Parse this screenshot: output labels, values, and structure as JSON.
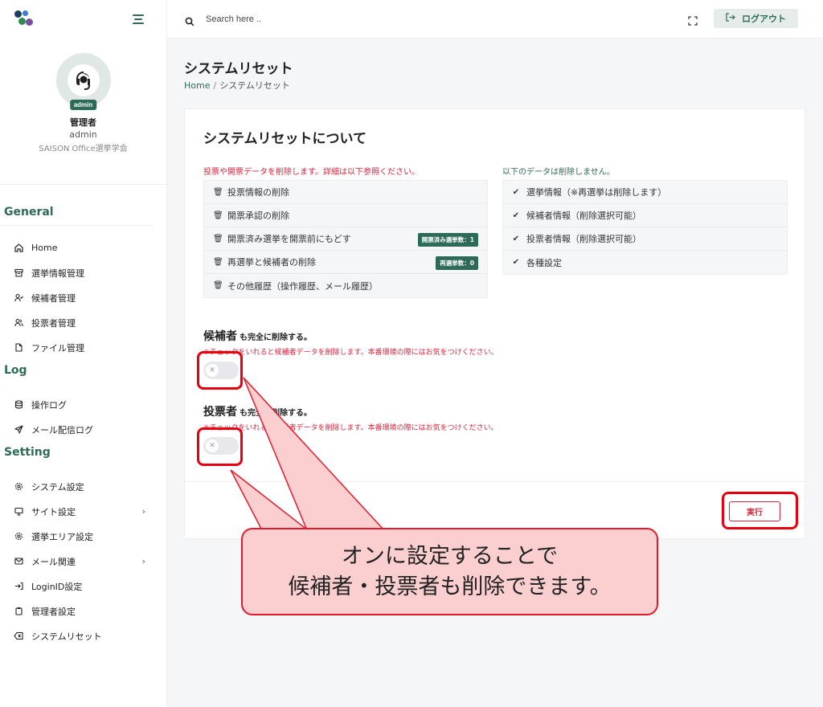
{
  "topbar": {
    "search_placeholder": "Search here ..",
    "logout_label": "ログアウト"
  },
  "profile": {
    "name": "管理者",
    "username": "admin",
    "organization": "SAISON Office選挙学会",
    "badge": "admin"
  },
  "sidebar": {
    "sections": {
      "general": "General",
      "log": "Log",
      "setting": "Setting"
    },
    "general_items": [
      {
        "label": "Home",
        "icon": "home-icon"
      },
      {
        "label": "選挙情報管理",
        "icon": "ballot-box-icon"
      },
      {
        "label": "候補者管理",
        "icon": "user-check-icon"
      },
      {
        "label": "投票者管理",
        "icon": "users-icon"
      },
      {
        "label": "ファイル管理",
        "icon": "file-icon"
      }
    ],
    "log_items": [
      {
        "label": "操作ログ",
        "icon": "database-icon"
      },
      {
        "label": "メール配信ログ",
        "icon": "send-icon"
      }
    ],
    "setting_items": [
      {
        "label": "システム設定",
        "icon": "gear-icon"
      },
      {
        "label": "サイト設定",
        "icon": "monitor-icon"
      },
      {
        "label": "選挙エリア設定",
        "icon": "gear-icon"
      },
      {
        "label": "メール関連",
        "icon": "mail-icon"
      },
      {
        "label": "LoginID設定",
        "icon": "login-icon"
      },
      {
        "label": "管理者設定",
        "icon": "clipboard-icon"
      },
      {
        "label": "システムリセット",
        "icon": "backspace-icon"
      }
    ]
  },
  "page": {
    "title": "システムリセット",
    "breadcrumb_home": "Home",
    "breadcrumb_current": "システムリセット"
  },
  "card": {
    "title": "システムリセットについて",
    "delete_heading": "投票や開票データを削除します。詳細は以下参照ください。",
    "keep_heading": "以下のデータは削除しません。",
    "delete_items": [
      {
        "label": "投票情報の削除",
        "badge": ""
      },
      {
        "label": "開票承認の削除",
        "badge": ""
      },
      {
        "label": "開票済み選挙を開票前にもどす",
        "badge": "開票済み選挙数：1"
      },
      {
        "label": "再選挙と候補者の削除",
        "badge": "再選挙数：0"
      },
      {
        "label": "その他履歴（操作履歴、メール履歴）",
        "badge": ""
      }
    ],
    "keep_items": [
      "選挙情報（※再選挙は削除します）",
      "候補者情報（削除選択可能）",
      "投票者情報（削除選択可能）",
      "各種設定"
    ],
    "candidate_option": {
      "title": "候補者",
      "suffix": "も完全に削除する。",
      "warning": "※チェックをいれると候補者データを削除します。本番環境の際にはお気をつけください。",
      "checked": false
    },
    "voter_option": {
      "title": "投票者",
      "suffix": "も完全に削除する。",
      "warning": "※チェックをいれると投票者データを削除します。本番環境の際にはお気をつけください。",
      "checked": false
    },
    "execute_label": "実行"
  },
  "annotation": {
    "line1": "オンに設定することで",
    "line2": "候補者・投票者も削除できます。"
  },
  "colors": {
    "accent": "#2d6a57",
    "danger": "#d6263e",
    "callout_bg": "#fbcfcf",
    "callout_border": "#e41a2c"
  }
}
